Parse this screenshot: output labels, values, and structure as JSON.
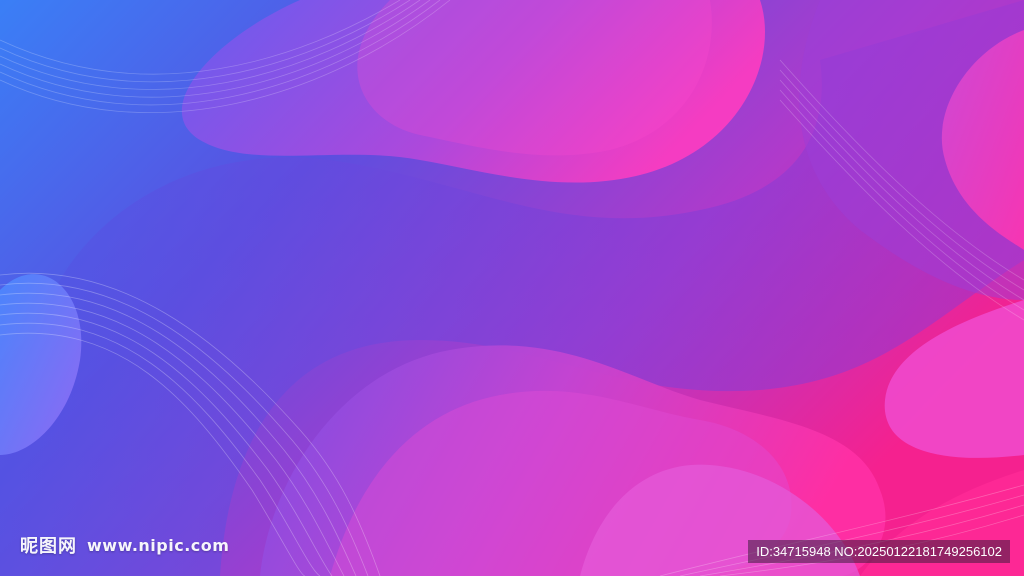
{
  "watermark": {
    "brand": "昵图网",
    "site": "www.nipic.com"
  },
  "id_badge": {
    "text": "ID:34715948 NO:20250122181749256102"
  },
  "colors": {
    "blue": "#3d7cf5",
    "violet": "#8a3fe0",
    "magenta": "#f22fa8",
    "hot_pink": "#ff2f9a"
  }
}
